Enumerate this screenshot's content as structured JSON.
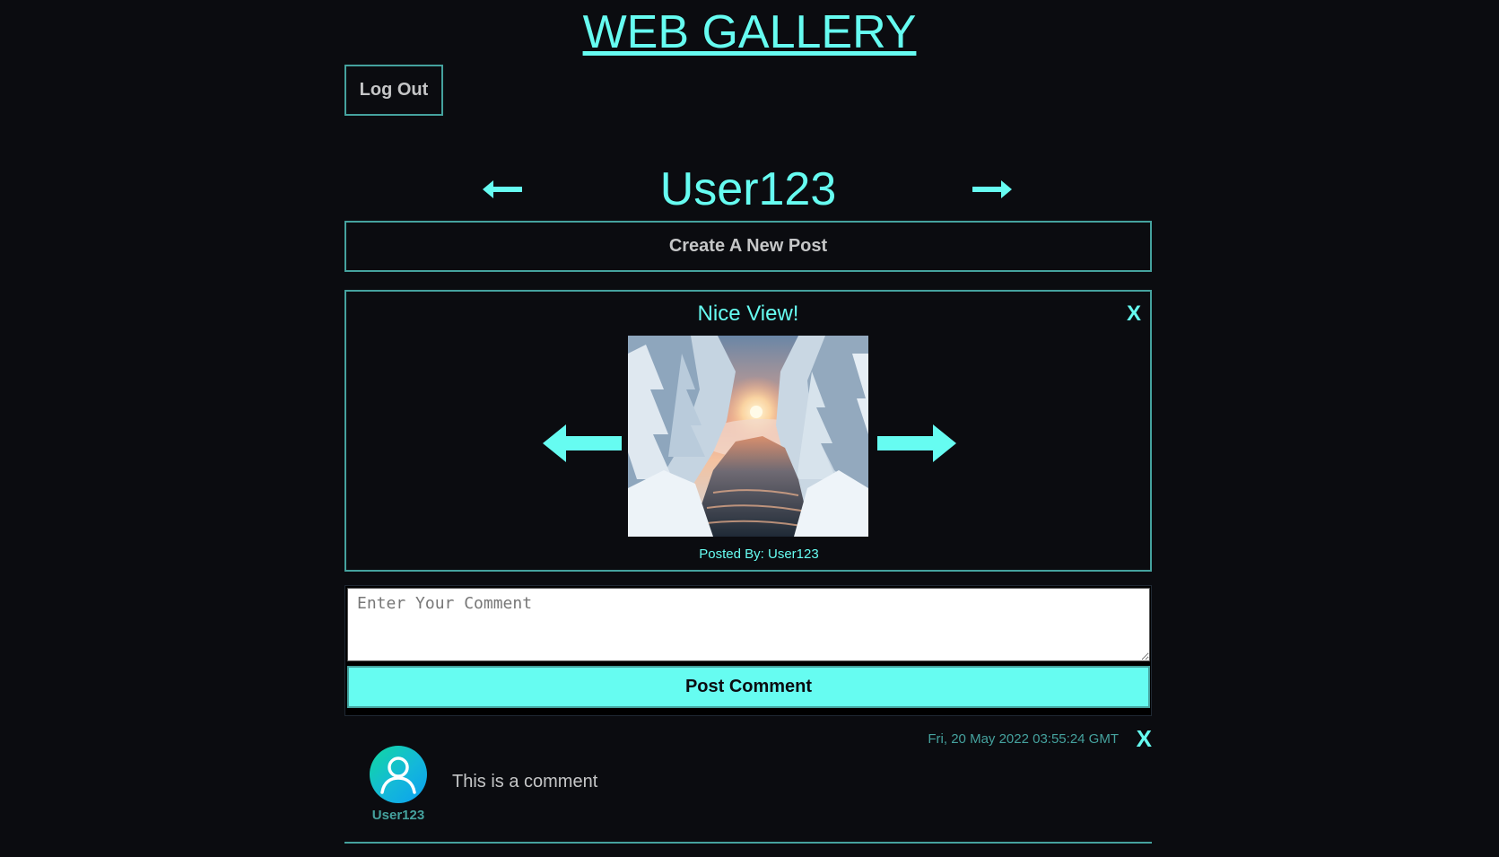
{
  "header": {
    "site_title": "WEB GALLERY"
  },
  "auth": {
    "logout_label": "Log Out"
  },
  "user_nav": {
    "username": "User123",
    "prev_icon": "arrow-left-icon",
    "next_icon": "arrow-right-icon"
  },
  "create_post": {
    "label": "Create A New Post"
  },
  "post": {
    "title": "Nice View!",
    "close_label": "X",
    "author_line": "Posted By: User123",
    "image_icon": "winter-river-sunset-photo"
  },
  "comment_form": {
    "placeholder": "Enter Your Comment",
    "value": "",
    "submit_label": "Post Comment"
  },
  "comments": [
    {
      "timestamp": "Fri, 20 May 2022 03:55:24 GMT",
      "close_label": "X",
      "author": "User123",
      "text": "This is a comment",
      "avatar_icon": "user-avatar-icon"
    }
  ],
  "colors": {
    "background": "#0b0c10",
    "accent": "#66fcf1",
    "border": "#45a29e",
    "text": "#c5c6c7"
  }
}
